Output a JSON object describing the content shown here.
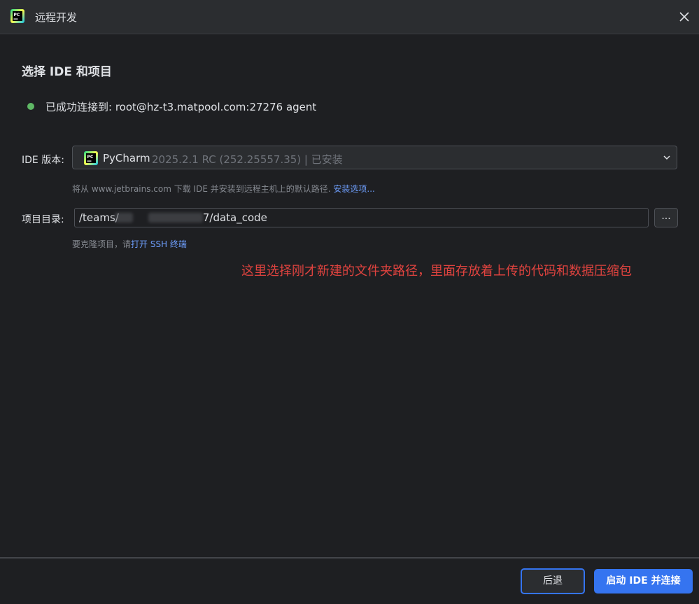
{
  "window": {
    "title": "远程开发"
  },
  "page": {
    "heading": "选择 IDE 和项目"
  },
  "status": {
    "text": "已成功连接到: root@hz-t3.matpool.com:27276 agent",
    "color": "#5fb865"
  },
  "ide": {
    "label": "IDE 版本:",
    "name": "PyCharm",
    "version": "2025.2.1 RC (252.25557.35) | 已安装",
    "hint_text": "将从 www.jetbrains.com 下载 IDE 并安装到远程主机上的默认路径.",
    "hint_link": "安装选项..."
  },
  "project": {
    "label": "项目目录:",
    "path": "/teams/",
    "path_end": "7/data_code",
    "browse_label": "...",
    "hint_text": "要克隆项目，请",
    "hint_link": "打开 SSH 终端"
  },
  "annotation": "这里选择刚才新建的文件夹路径，里面存放着上传的代码和数据压缩包",
  "footer": {
    "back_label": "后退",
    "start_label": "启动 IDE 并连接"
  },
  "icons": {
    "app": "pycharm-logo-icon",
    "close": "close-icon",
    "dropdown": "chevron-down-icon"
  },
  "colors": {
    "accent": "#3574f0",
    "annotation": "#e0433f",
    "link": "#6e9efc"
  }
}
